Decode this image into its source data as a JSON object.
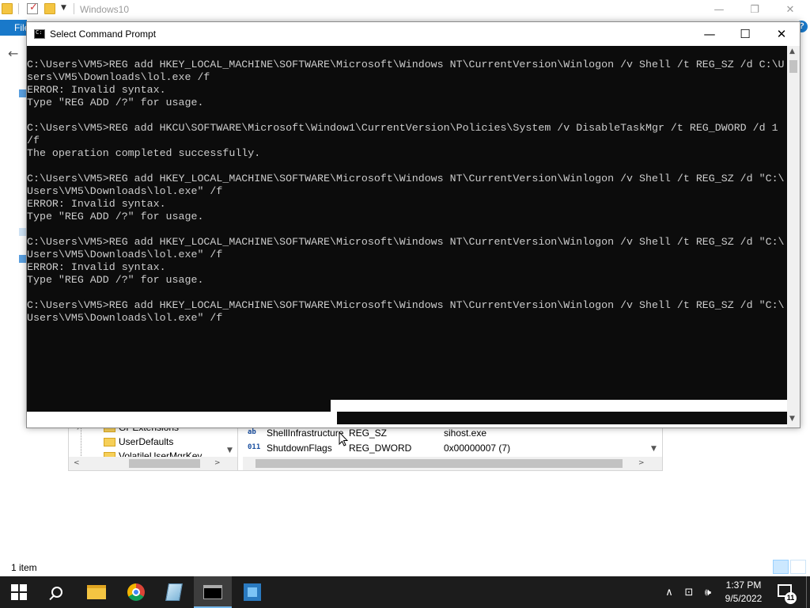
{
  "explorer": {
    "title": "Windows10",
    "ribbon_file": "File",
    "help": "?",
    "status": "1 item",
    "ctrl_minimize": "—",
    "ctrl_restore": "❐",
    "ctrl_close": "✕"
  },
  "regedit": {
    "tree_items": [
      "GPExtensions",
      "UserDefaults",
      "VolatileUserMgrKey"
    ],
    "values": [
      {
        "icon": "ab",
        "name": "ShellInfrastructure",
        "type": "REG_SZ",
        "data": "sihost.exe"
      },
      {
        "icon": "011",
        "name": "ShutdownFlags",
        "type": "REG_DWORD",
        "data": "0x00000007 (7)"
      }
    ]
  },
  "cmd": {
    "title": "Select Command Prompt",
    "ctrl_minimize": "—",
    "ctrl_maximize": "☐",
    "ctrl_close": "✕",
    "lines": [
      "C:\\Users\\VM5>REG add HKEY_LOCAL_MACHINE\\SOFTWARE\\Microsoft\\Windows NT\\CurrentVersion\\Winlogon /v Shell /t REG_SZ /d C:\\U",
      "sers\\VM5\\Downloads\\lol.exe /f",
      "ERROR: Invalid syntax.",
      "Type \"REG ADD /?\" for usage.",
      "",
      "C:\\Users\\VM5>REG add HKCU\\SOFTWARE\\Microsoft\\Window1\\CurrentVersion\\Policies\\System /v DisableTaskMgr /t REG_DWORD /d 1",
      "/f",
      "The operation completed successfully.",
      "",
      "C:\\Users\\VM5>REG add HKEY_LOCAL_MACHINE\\SOFTWARE\\Microsoft\\Windows NT\\CurrentVersion\\Winlogon /v Shell /t REG_SZ /d \"C:\\",
      "Users\\VM5\\Downloads\\lol.exe\" /f",
      "ERROR: Invalid syntax.",
      "Type \"REG ADD /?\" for usage.",
      "",
      "C:\\Users\\VM5>REG add HKEY_LOCAL_MACHINE\\SOFTWARE\\Microsoft\\Windows NT\\CurrentVersion\\Winlogon /v Shell /t REG_SZ /d \"C:\\",
      "Users\\VM5\\Downloads\\lol.exe\" /f",
      "ERROR: Invalid syntax.",
      "Type \"REG ADD /?\" for usage.",
      "",
      "C:\\Users\\VM5>REG add HKEY_LOCAL_MACHINE\\SOFTWARE\\Microsoft\\Windows NT\\CurrentVersion\\Winlogon /v Shell /t REG_SZ /d \"C:\\",
      "Users\\VM5\\Downloads\\lol.exe\" /f"
    ]
  },
  "taskbar": {
    "apps": [
      {
        "name": "start",
        "icon": "windows-logo-icon"
      },
      {
        "name": "search",
        "icon": "search-icon"
      },
      {
        "name": "file-explorer",
        "icon": "folder-icon"
      },
      {
        "name": "chrome",
        "icon": "chrome-icon"
      },
      {
        "name": "notepad",
        "icon": "notepad-icon"
      },
      {
        "name": "command-prompt",
        "icon": "cmd-icon",
        "active": true
      },
      {
        "name": "registry-editor",
        "icon": "regedit-icon"
      }
    ],
    "tray": {
      "chevron": "∧",
      "network": "⊡",
      "volume": "🕪"
    },
    "time": "1:37 PM",
    "date": "9/5/2022",
    "notification_count": "11"
  },
  "colors": {
    "console_bg": "#0c0c0c",
    "console_text": "#cccccc",
    "taskbar_bg": "#1c1c1c",
    "accent": "#1979ca"
  }
}
